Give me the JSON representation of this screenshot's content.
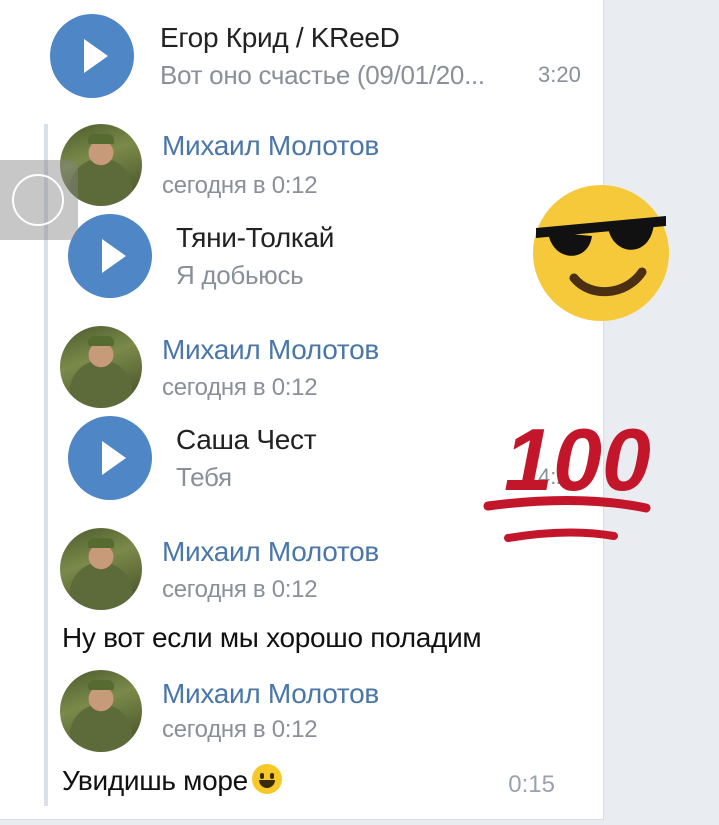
{
  "top_track": {
    "title": "Егор Крид / KReeD",
    "artist": "Вот оно счастье (09/01/20...",
    "duration": "3:20"
  },
  "messages": [
    {
      "sender": "Михаил Молотов",
      "time": "сегодня в 0:12",
      "track": {
        "title": "Тяни-Толкай",
        "artist": "Я добьюсь"
      }
    },
    {
      "sender": "Михаил Молотов",
      "time": "сегодня в 0:12",
      "track": {
        "title": "Саша Чест",
        "artist": "Тебя",
        "duration": "4:2"
      }
    },
    {
      "sender": "Михаил Молотов",
      "time": "сегодня в 0:12",
      "text": "Ну вот если мы хорошо поладим"
    },
    {
      "sender": "Михаил Молотов",
      "time": "сегодня в 0:12",
      "text": "Увидишь море"
    }
  ],
  "footer": {
    "timestamp": "0:15"
  },
  "stickers": {
    "hundred_text": "100"
  },
  "icons": {
    "play": "play-icon",
    "scroll": "scroll-handle",
    "cool": "sunglasses-emoji",
    "hundred": "hundred-points-emoji",
    "smile": "smiley-emoji"
  },
  "colors": {
    "accent": "#4f86c6",
    "sender": "#4a76a8",
    "meta": "#8a9099",
    "background": "#e9edf2"
  }
}
